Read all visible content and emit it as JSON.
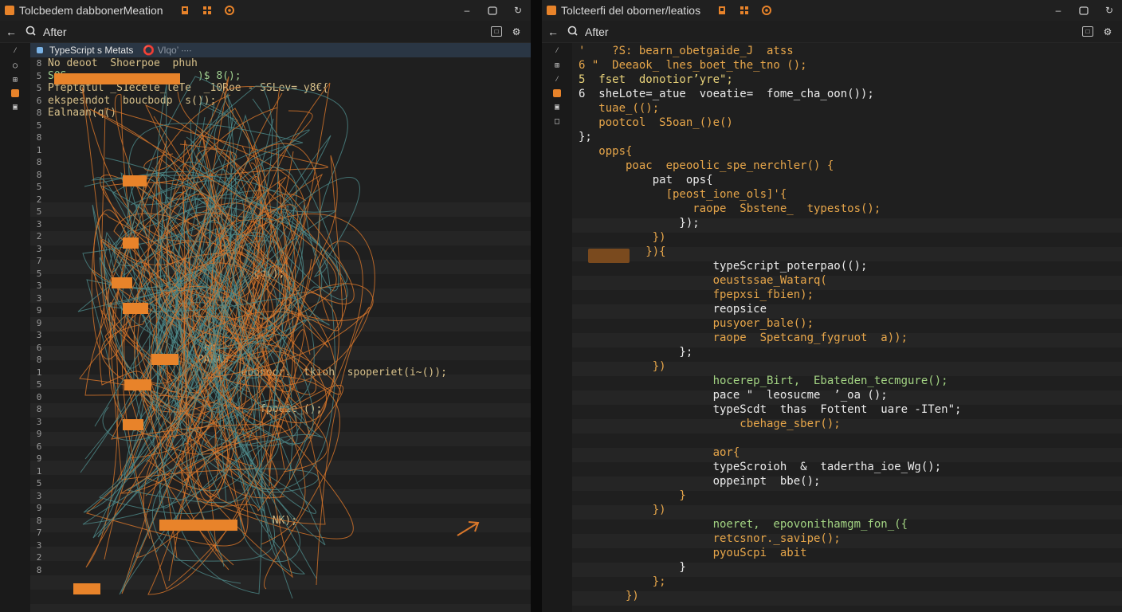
{
  "left_window": {
    "title": "Tolcbedem dabbonerMeation",
    "toolbar_label": "After",
    "tab_label": "TypeScript s Metats",
    "tab_faint": "⭕ Vlqo’ ∙∙∙∙",
    "line_numbers": [
      "8",
      "5",
      "5",
      "6",
      "8",
      "5",
      "8",
      "1",
      "8",
      "8",
      "5",
      "2",
      "5",
      "3",
      "2",
      "3",
      "7",
      "5",
      "3",
      "3",
      "9",
      "9",
      "3",
      "6",
      "8",
      "1",
      "5",
      "0",
      "8",
      "3",
      "9",
      "6",
      "9",
      "1",
      "5",
      "3",
      "9",
      "8",
      "7",
      "3",
      "2",
      "8"
    ],
    "code_lines": [
      "No deoot  Shoerpoe  phuh",
      "S0S                     )$ 8();",
      "Pfeptgtul _S1ecele_leTe  _10Roe - SSLev= y8€{",
      "ekspesndot  boucbodp  s());",
      "Ealnaan(q()",
      "",
      "",
      "",
      "",
      "",
      "",
      "",
      "",
      "",
      "",
      "",
      "",
      "                                 çd();",
      "",
      "",
      "",
      "",
      "",
      "                         bb",
      "                        PARAS",
      "                               ebonoor.  tkioh  spoperiet(i~());",
      "",
      "",
      "                                  fpoeie_();",
      "",
      "",
      "",
      "",
      "",
      "",
      "",
      "",
      "                                    NK);",
      "",
      "",
      "",
      ""
    ]
  },
  "right_window": {
    "title": "Tolcteerfi del  oborner/leatios",
    "toolbar_label": "After",
    "code_lines": [
      "'    ?S: bearn_obetgaide_J  atss",
      "6 \"  Deeaok_ lnes_boet_the_tno ();",
      "5  fset  donotior’yre\";",
      "6  sheLote=_atue  voeatie=  fome_cha_oon());",
      "   tuae_(();",
      "   pootcol  S5oan_()e()",
      "};",
      "   opps{",
      "       poac  epeoolic_spe_nerchler() {",
      "           pat  ops{",
      "             [peost_ione_ols]'{",
      "                 raope  Sbstene_  typestos();",
      "               });",
      "           })",
      "          }){",
      "                    typeScript_poterpao(();",
      "                    oeustssae_Watarq(",
      "                    fpepxsi_fbien);",
      "                    reopsice",
      "                    pusyoer_bale();",
      "                    raope  Spetcang_fygruot  a));",
      "               };",
      "           })",
      "                    hocerep_Birt,  Ebateden_tecmgure();",
      "                    pace \"  leosucme  ’_oa ();",
      "                    typeScdt  thas  Fottent  uare -ITen\";",
      "                        cbehage_sber();",
      "",
      "                    aor{",
      "                    typeScroioh  &  tadertha_ioe_Wg();",
      "                    oppeinpt  bbe();",
      "               }",
      "           })",
      "                    noeret,  epovonithamgm_fon_({",
      "                    retcsnor._savipe();",
      "                    pyouScpi  abit",
      "               }",
      "           };",
      "       })"
    ]
  },
  "colors": {
    "accent": "#e8832a",
    "tab_bg": "#2a3644",
    "editor_bg": "#1f1f1f",
    "scribble_orange": "#d9772a",
    "scribble_teal": "#4e8a8a"
  }
}
